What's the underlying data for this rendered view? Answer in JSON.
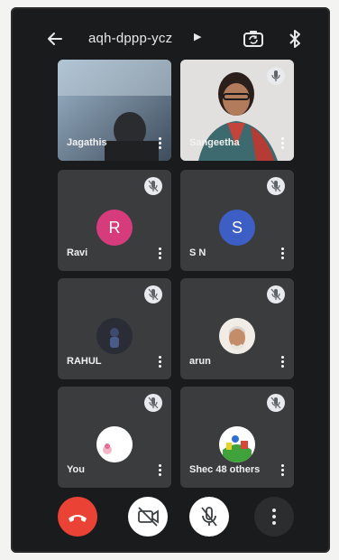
{
  "meeting": {
    "code": "aqh-dppp-ycz"
  },
  "icons": {
    "back": "arrow-back-icon",
    "switch_camera": "switch-camera-icon",
    "bluetooth": "bluetooth-icon",
    "end_call": "end-call-icon",
    "camera_off": "camera-off-icon",
    "mic_off": "mic-off-icon",
    "more": "more-vert-icon"
  },
  "colors": {
    "end_call": "#ea4335",
    "tile": "#3b3c3e",
    "background": "#1a1b1c",
    "avatar_ravi": "#d63c7c",
    "avatar_sn": "#3d5ec4"
  },
  "participants": [
    {
      "name": "Jagathis",
      "type": "video"
    },
    {
      "name": "Sangeetha",
      "type": "video"
    },
    {
      "name": "Ravi",
      "type": "letter",
      "initial": "R"
    },
    {
      "name": "S N",
      "type": "letter",
      "initial": "S"
    },
    {
      "name": "RAHUL",
      "type": "photo"
    },
    {
      "name": "arun",
      "type": "photo"
    },
    {
      "name": "You",
      "type": "photo"
    },
    {
      "name": "Shec 48 others",
      "type": "photo"
    }
  ]
}
